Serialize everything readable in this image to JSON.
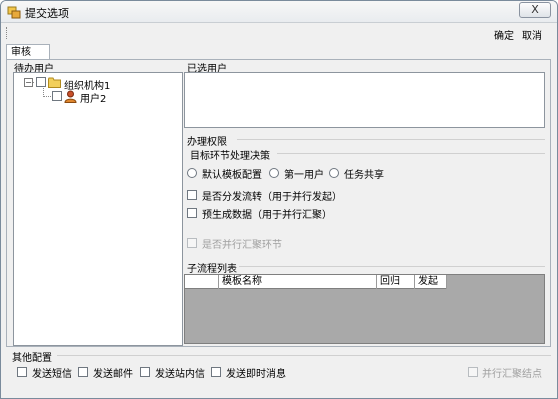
{
  "window": {
    "title": "提交选项",
    "close_glyph": "X"
  },
  "toolbar": {
    "confirm_label": "确定",
    "cancel_label": "取消"
  },
  "tabs": [
    {
      "label": "审核",
      "selected": true
    }
  ],
  "pending_users": {
    "label": "待办用户",
    "tree": [
      {
        "label": "组织机构1",
        "icon": "folder-icon",
        "expanded": true,
        "expander_glyph": "−",
        "children": [
          {
            "label": "用户2",
            "icon": "user-icon"
          }
        ]
      }
    ]
  },
  "selected_users": {
    "label": "已选用户"
  },
  "permissions": {
    "label": "办理权限",
    "target_policy": {
      "label": "目标环节处理决策",
      "options": [
        {
          "label": "默认模板配置",
          "checked": false
        },
        {
          "label": "第一用户",
          "checked": false
        },
        {
          "label": "任务共享",
          "checked": false
        }
      ]
    },
    "checkboxes": [
      {
        "label": "是否分发流转（用于并行发起）",
        "checked": false,
        "enabled": true
      },
      {
        "label": "预生成数据（用于并行汇聚）",
        "checked": false,
        "enabled": true
      },
      {
        "label": "是否并行汇聚环节",
        "checked": false,
        "enabled": false
      }
    ]
  },
  "subprocess": {
    "label": "子流程列表",
    "columns": [
      "模板名称",
      "回归",
      "发起"
    ]
  },
  "other_config": {
    "label": "其他配置",
    "options": [
      {
        "label": "发送短信",
        "checked": false,
        "enabled": true
      },
      {
        "label": "发送邮件",
        "checked": false,
        "enabled": true
      },
      {
        "label": "发送站内信",
        "checked": false,
        "enabled": true
      },
      {
        "label": "发送即时消息",
        "checked": false,
        "enabled": true
      }
    ],
    "parallel_node": {
      "label": "并行汇聚结点",
      "checked": false,
      "enabled": false
    }
  }
}
